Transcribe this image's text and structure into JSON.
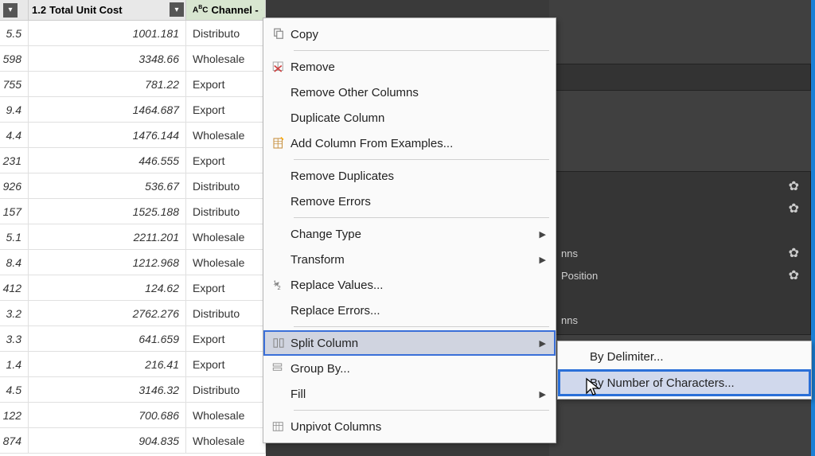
{
  "columns": {
    "col1_type": "1.2",
    "col2_label": "Total Unit Cost",
    "col3_type_prefix": "A",
    "col3_type_suffix": "C",
    "col3_type_sub": "B",
    "col3_label": "Channel - Copy"
  },
  "rows": [
    {
      "a": "5.5",
      "b": "1001.181",
      "c": "Distributo"
    },
    {
      "a": "598",
      "b": "3348.66",
      "c": "Wholesale"
    },
    {
      "a": "755",
      "b": "781.22",
      "c": "Export"
    },
    {
      "a": "9.4",
      "b": "1464.687",
      "c": "Export"
    },
    {
      "a": "4.4",
      "b": "1476.144",
      "c": "Wholesale"
    },
    {
      "a": "231",
      "b": "446.555",
      "c": "Export"
    },
    {
      "a": "926",
      "b": "536.67",
      "c": "Distributo"
    },
    {
      "a": "157",
      "b": "1525.188",
      "c": "Distributo"
    },
    {
      "a": "5.1",
      "b": "2211.201",
      "c": "Wholesale"
    },
    {
      "a": "8.4",
      "b": "1212.968",
      "c": "Wholesale"
    },
    {
      "a": "412",
      "b": "124.62",
      "c": "Export"
    },
    {
      "a": "3.2",
      "b": "2762.276",
      "c": "Distributo"
    },
    {
      "a": "3.3",
      "b": "641.659",
      "c": "Export"
    },
    {
      "a": "1.4",
      "b": "216.41",
      "c": "Export"
    },
    {
      "a": "4.5",
      "b": "3146.32",
      "c": "Distributo"
    },
    {
      "a": "122",
      "b": "700.686",
      "c": "Wholesale"
    },
    {
      "a": "874",
      "b": "904.835",
      "c": "Wholesale"
    }
  ],
  "panel": {
    "item1": "nns",
    "item2": "Position",
    "item3": "nns"
  },
  "menu": {
    "copy": "Copy",
    "remove": "Remove",
    "remove_other": "Remove Other Columns",
    "duplicate": "Duplicate Column",
    "add_example": "Add Column From Examples...",
    "remove_dup": "Remove Duplicates",
    "remove_err": "Remove Errors",
    "change_type": "Change Type",
    "transform": "Transform",
    "replace_val": "Replace Values...",
    "replace_err": "Replace Errors...",
    "split": "Split Column",
    "group": "Group By...",
    "fill": "Fill",
    "unpivot": "Unpivot Columns"
  },
  "submenu": {
    "delimiter": "By Delimiter...",
    "numchars": "By Number of Characters..."
  }
}
